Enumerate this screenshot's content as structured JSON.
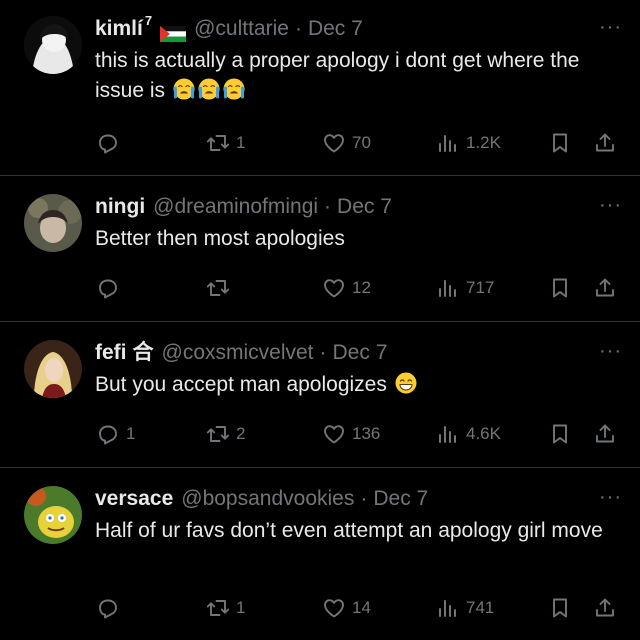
{
  "tweets": [
    {
      "name": "kimlí",
      "badge": "7",
      "flag": "palestine-flag",
      "handle": "@culttarie",
      "date": "Dec 7",
      "text": "this is actually a proper apology i dont get where the issue is",
      "emoji": [
        "loudly-crying-face",
        "loudly-crying-face",
        "loudly-crying-face"
      ],
      "metrics": {
        "replies": "",
        "retweets": "1",
        "likes": "70",
        "views": "1.2K"
      }
    },
    {
      "name": "ningi",
      "handle": "@dreaminofmingi",
      "date": "Dec 7",
      "text": "Better then most apologies",
      "metrics": {
        "replies": "",
        "retweets": "",
        "likes": "12",
        "views": "717"
      }
    },
    {
      "name": "fefi",
      "name_symbol": "合",
      "handle": "@coxsmicvelvet",
      "date": "Dec 7",
      "text": "But you accept man apologizes",
      "emoji": [
        "grinning-face-with-smiling-eyes"
      ],
      "metrics": {
        "replies": "1",
        "retweets": "2",
        "likes": "136",
        "views": "4.6K"
      }
    },
    {
      "name": "versace",
      "handle": "@bopsandvookies",
      "date": "Dec 7",
      "text": "Half of ur favs don’t even attempt an apology girl move",
      "metrics": {
        "replies": "",
        "retweets": "1",
        "likes": "14",
        "views": "741"
      }
    }
  ],
  "separator": "·",
  "more": "···",
  "colors": {
    "background": "#000000",
    "text": "#e7e9ea",
    "muted": "#71767b",
    "divider": "#2f3336",
    "emoji": "#ffcc33"
  }
}
